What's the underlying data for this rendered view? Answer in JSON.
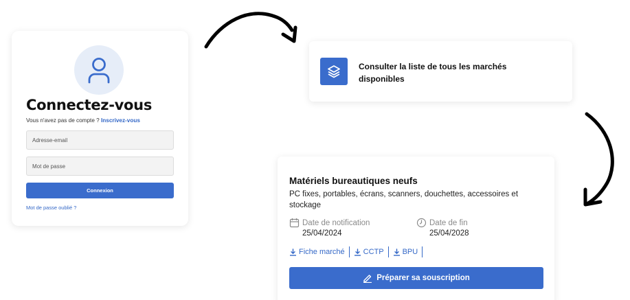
{
  "login": {
    "avatar_icon": "user-icon",
    "title": "Connectez-vous",
    "signup_prompt": "Vous n'avez pas de compte ?",
    "signup_link": "Inscrivez-vous",
    "email_placeholder": "Adresse-email",
    "password_placeholder": "Mot de passe",
    "submit_label": "Connexion",
    "forgot_link": "Mot de passe oublié ?"
  },
  "list_card": {
    "icon": "layers-icon",
    "text": "Consulter la liste de tous les marchés disponibles"
  },
  "market": {
    "title": "Matériels bureautiques neufs",
    "description": "PC fixes, portables, écrans, scanners, douchettes, accessoires et stockage",
    "notification_label": "Date de notification",
    "notification_value": "25/04/2024",
    "end_label": "Date de fin",
    "end_value": "25/04/2028",
    "documents": [
      "Fiche marché",
      "CCTP",
      "BPU"
    ],
    "prepare_label": "Préparer sa souscription"
  },
  "colors": {
    "accent": "#3a6ccc",
    "link": "#3468c7",
    "avatar_bg": "#e6edf8"
  }
}
